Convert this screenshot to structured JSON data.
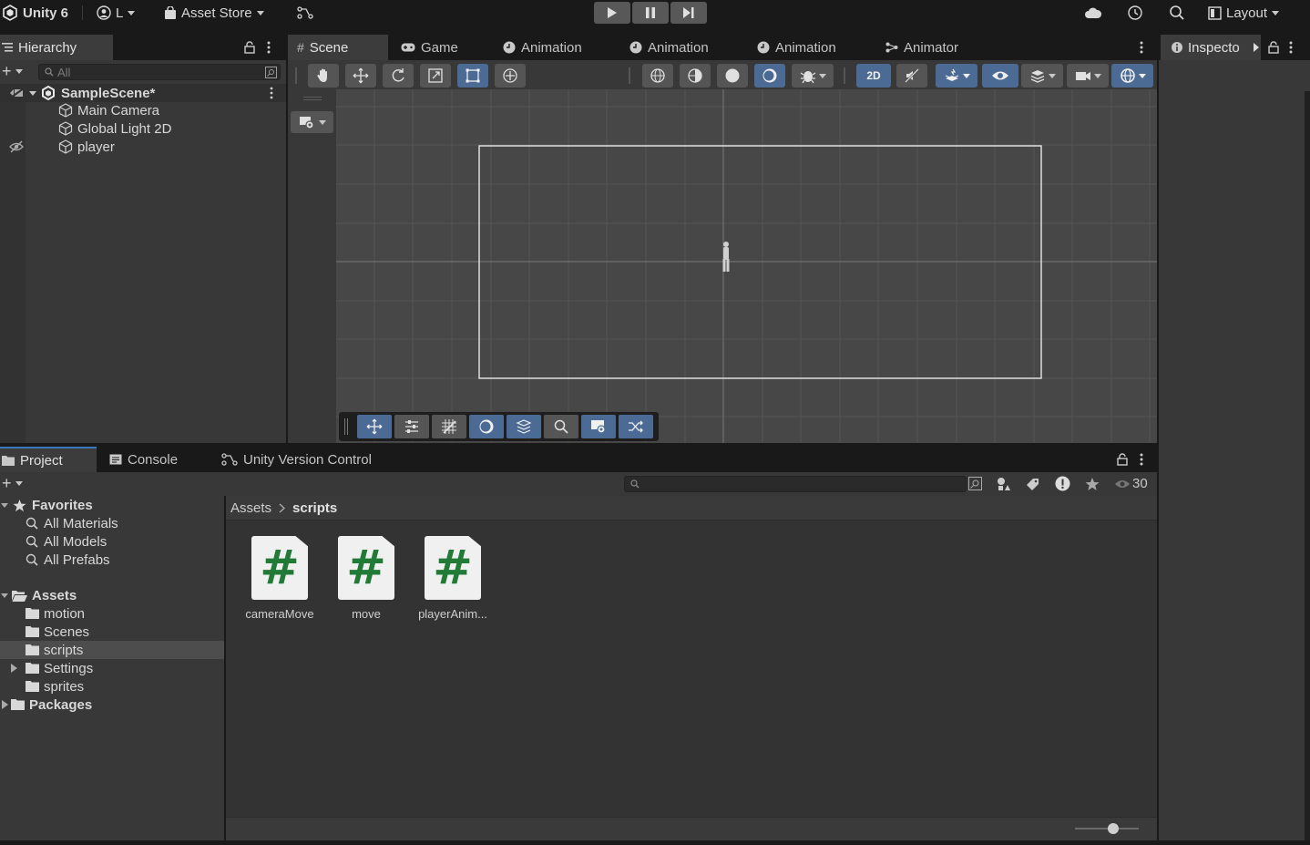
{
  "topbar": {
    "app_title": "Unity 6",
    "account": "L",
    "asset_store": "Asset Store",
    "layout": "Layout"
  },
  "hierarchy": {
    "tab": "Hierarchy",
    "search_placeholder": "All",
    "scene_name": "SampleScene*",
    "items": [
      "Main Camera",
      "Global Light 2D",
      "player"
    ]
  },
  "center_tabs": [
    "Scene",
    "Game",
    "Animation",
    "Animation",
    "Animation",
    "Animator"
  ],
  "inspector": {
    "tab": "Inspecto"
  },
  "scene_toolbar": {
    "mode_2d": "2D"
  },
  "bottom_tabs": [
    "Project",
    "Console",
    "Unity Version Control"
  ],
  "project": {
    "visible_count": "30",
    "favorites": {
      "label": "Favorites",
      "items": [
        "All Materials",
        "All Models",
        "All Prefabs"
      ]
    },
    "assets": {
      "label": "Assets",
      "folders": [
        "motion",
        "Scenes",
        "scripts",
        "Settings",
        "sprites"
      ]
    },
    "packages": "Packages",
    "breadcrumb": {
      "root": "Assets",
      "current": "scripts"
    },
    "files": [
      {
        "name": "cameraMove",
        "glyph": "#"
      },
      {
        "name": "move",
        "glyph": "#"
      },
      {
        "name": "playerAnim...",
        "glyph": "#"
      }
    ],
    "zoom_slider": 0.6
  },
  "colors": {
    "accent_blue": "#3a79bb",
    "toggle_on": "#4b6a94",
    "selection": "#4d4d4d",
    "script_hash": "#217a36"
  }
}
